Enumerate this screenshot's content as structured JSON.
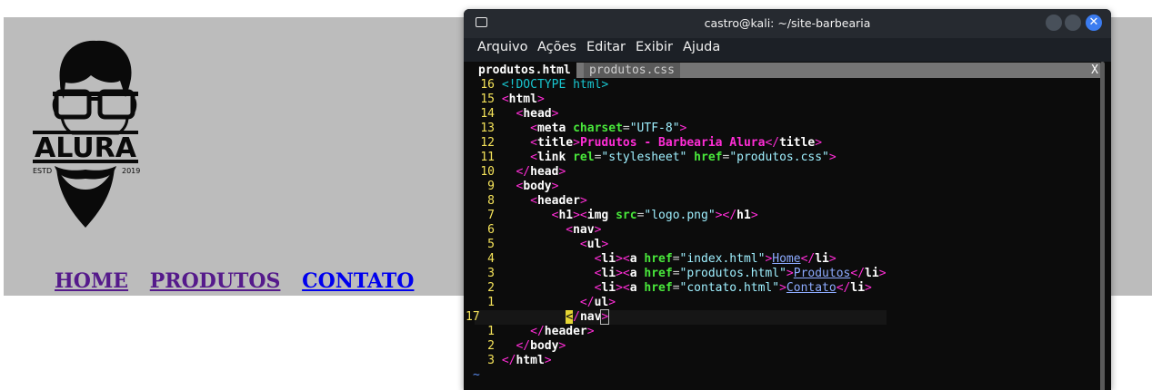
{
  "nav": {
    "home": "HOME",
    "produtos": "PRODUTOS",
    "contato": "CONTATO"
  },
  "logo": {
    "brand": "ALURA",
    "estd": "ESTD",
    "year": "2019"
  },
  "terminal": {
    "title": "castro@kali: ~/site-barbearia",
    "menu": [
      "Arquivo",
      "Ações",
      "Editar",
      "Exibir",
      "Ajuda"
    ],
    "tabs": [
      "produtos.html",
      "produtos.css"
    ],
    "close_tab": "X",
    "window_close": "✕",
    "tilde": "~",
    "lines": [
      {
        "n": "16",
        "indent": "",
        "html": "<span class=\"d\">&lt;!DOCTYPE html&gt;</span>"
      },
      {
        "n": "15",
        "indent": "",
        "html": "<span class=\"p\">&lt;</span><span class=\"t\">html</span><span class=\"p\">&gt;</span>"
      },
      {
        "n": "14",
        "indent": "  ",
        "html": "<span class=\"p\">&lt;</span><span class=\"t\">head</span><span class=\"p\">&gt;</span>"
      },
      {
        "n": "13",
        "indent": "    ",
        "html": "<span class=\"p\">&lt;</span><span class=\"t\">meta</span> <span class=\"a\">charset</span>=<span class=\"s\">\"UTF-8\"</span><span class=\"p\">&gt;</span>"
      },
      {
        "n": "12",
        "indent": "    ",
        "html": "<span class=\"p\">&lt;</span><span class=\"t\">title</span><span class=\"p\">&gt;</span><span class=\"tx\">Prudutos - Barbearia Alura</span><span class=\"p\">&lt;/</span><span class=\"t\">title</span><span class=\"p\">&gt;</span>"
      },
      {
        "n": "11",
        "indent": "    ",
        "html": "<span class=\"p\">&lt;</span><span class=\"t\">link</span> <span class=\"a\">rel</span>=<span class=\"s\">\"stylesheet\"</span> <span class=\"a\">href</span>=<span class=\"s\">\"produtos.css\"</span><span class=\"p\">&gt;</span>"
      },
      {
        "n": "10",
        "indent": "  ",
        "html": "<span class=\"p\">&lt;/</span><span class=\"t\">head</span><span class=\"p\">&gt;</span>"
      },
      {
        "n": "9",
        "indent": "  ",
        "html": "<span class=\"p\">&lt;</span><span class=\"t\">body</span><span class=\"p\">&gt;</span>"
      },
      {
        "n": "8",
        "indent": "    ",
        "html": "<span class=\"p\">&lt;</span><span class=\"t\">header</span><span class=\"p\">&gt;</span>"
      },
      {
        "n": "7",
        "indent": "       ",
        "html": "<span class=\"p\">&lt;</span><span class=\"t\">h1</span><span class=\"p\">&gt;&lt;</span><span class=\"t\">img</span> <span class=\"a\">src</span>=<span class=\"s\">\"logo.png\"</span><span class=\"p\">&gt;&lt;/</span><span class=\"t\">h1</span><span class=\"p\">&gt;</span>"
      },
      {
        "n": "6",
        "indent": "         ",
        "html": "<span class=\"p\">&lt;</span><span class=\"t\">nav</span><span class=\"p\">&gt;</span>"
      },
      {
        "n": "5",
        "indent": "           ",
        "html": "<span class=\"p\">&lt;</span><span class=\"t\">ul</span><span class=\"p\">&gt;</span>"
      },
      {
        "n": "4",
        "indent": "             ",
        "html": "<span class=\"p\">&lt;</span><span class=\"t\">li</span><span class=\"p\">&gt;&lt;</span><span class=\"t\">a</span> <span class=\"a\">href</span>=<span class=\"s\">\"index.html\"</span><span class=\"p\">&gt;</span><span class=\"lk\">Home</span><span class=\"p\">&lt;/</span><span class=\"t\">li</span><span class=\"p\">&gt;</span>"
      },
      {
        "n": "3",
        "indent": "             ",
        "html": "<span class=\"p\">&lt;</span><span class=\"t\">li</span><span class=\"p\">&gt;&lt;</span><span class=\"t\">a</span> <span class=\"a\">href</span>=<span class=\"s\">\"produtos.html\"</span><span class=\"p\">&gt;</span><span class=\"lk\">Produtos</span><span class=\"p\">&lt;/</span><span class=\"t\">li</span><span class=\"p\">&gt;</span>"
      },
      {
        "n": "2",
        "indent": "             ",
        "html": "<span class=\"p\">&lt;</span><span class=\"t\">li</span><span class=\"p\">&gt;&lt;</span><span class=\"t\">a</span> <span class=\"a\">href</span>=<span class=\"s\">\"contato.html\"</span><span class=\"p\">&gt;</span><span class=\"lk\">Contato</span><span class=\"p\">&lt;/</span><span class=\"t\">li</span><span class=\"p\">&gt;</span>"
      },
      {
        "n": "1",
        "indent": "           ",
        "html": "<span class=\"p\">&lt;/</span><span class=\"t\">ul</span><span class=\"p\">&gt;</span>"
      },
      {
        "n": "17",
        "indent": "         ",
        "current": true,
        "html": "<span class=\"cursor\">&lt;</span><span class=\"p\">/</span><span class=\"t\">nav</span><span class=\"p mb\">&gt;</span>"
      },
      {
        "n": "1",
        "indent": "    ",
        "html": "<span class=\"p\">&lt;/</span><span class=\"t\">header</span><span class=\"p\">&gt;</span>"
      },
      {
        "n": "2",
        "indent": "  ",
        "html": "<span class=\"p\">&lt;/</span><span class=\"t\">body</span><span class=\"p\">&gt;</span>"
      },
      {
        "n": "3",
        "indent": "",
        "html": "<span class=\"p\">&lt;/</span><span class=\"t\">html</span><span class=\"p\">&gt;</span>"
      }
    ]
  }
}
